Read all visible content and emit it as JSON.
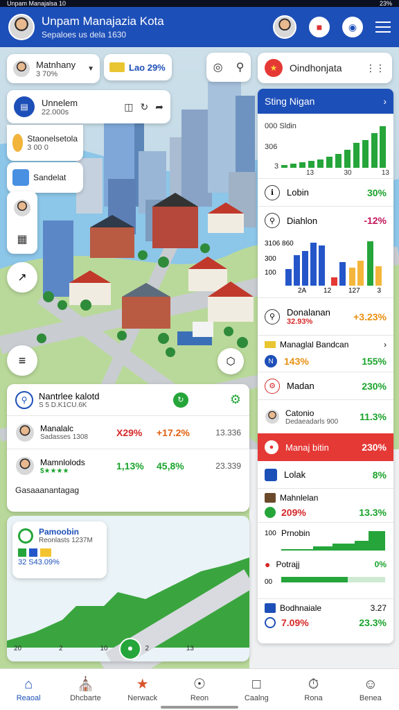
{
  "status_bar": {
    "left": "Unpam Manajalsa 10",
    "right": "23%"
  },
  "header": {
    "title": "Unpam Manajazia Kota",
    "subtitle": "Sepaloes us dela 1630"
  },
  "user_select": {
    "name": "Matnhany",
    "sub": "3 70%"
  },
  "budget_badge": {
    "value": "Lao 29%"
  },
  "side_list": [
    {
      "name": "Unnelem",
      "sub": "22.000s"
    },
    {
      "name": "Staonelsetola",
      "sub": "3 00 0"
    },
    {
      "name": "Sandelat",
      "sub": ""
    }
  ],
  "right_tab": {
    "label": "Oindhonjata"
  },
  "panel": {
    "header": "Sting Nigan",
    "chart1": {
      "label_top": "000 Sldin",
      "label_mid": "306",
      "label_bottom": "3",
      "ticks": [
        "13",
        "30",
        "13"
      ]
    },
    "rows": [
      {
        "label": "Lobin",
        "value": "30%",
        "color": "green"
      },
      {
        "label": "Diahlon",
        "value": "-12%",
        "color": "magenta"
      }
    ],
    "chart2": {
      "labels": [
        "2A",
        "12",
        "127",
        "3"
      ],
      "axis": [
        "3106 860",
        "300",
        "100"
      ]
    },
    "dana": {
      "label": "Donalanan",
      "sub": "32.93%",
      "value": "+3.23%"
    },
    "mana_row": {
      "label": "Managlal Bandcan",
      "left": "143%",
      "right": "155%"
    },
    "madan": {
      "label": "Madan",
      "value": "230%"
    },
    "catonio": {
      "label": "Catonio",
      "sub": "Dedaeadarls 900",
      "value": "11.3%"
    },
    "red_header": {
      "label": "Manaj bitin",
      "value": "230%"
    },
    "list": [
      {
        "label": "Lolak",
        "value": "8%",
        "left": ""
      },
      {
        "label": "Mahnlelan",
        "value": "13.3%",
        "left": "209%"
      }
    ],
    "mini": {
      "axis_top": "100",
      "label": "Prnobin",
      "label2": "Potrajj",
      "value2": "0%",
      "axis_bottom": "00"
    },
    "bottom": {
      "label": "Bodhnaiale",
      "right_top": "3.27",
      "left": "7.09%",
      "right": "23.3%"
    }
  },
  "stats_card": {
    "title": "Nantrlee kalotd",
    "sub": "S 5 D.K1CU.6K",
    "rows": [
      {
        "name": "Manalalc",
        "sub": "Sadasses 1308",
        "v1": "X29%",
        "v2": "+17.2%",
        "v3": "13.336"
      },
      {
        "name": "Mamnlolods",
        "sub": "$★★★★",
        "v1": "1,13%",
        "v2": "45,8%",
        "v3": "23.339"
      }
    ],
    "footer": "Gasaaanantagag"
  },
  "area_card": {
    "title": "Pamoobin",
    "sub": "Reonlasts 1237M",
    "legend": "32 S43.09%",
    "x_ticks": [
      "20",
      "2",
      "10",
      "2",
      "13"
    ]
  },
  "bottom_nav": [
    {
      "label": "Reaoal",
      "icon": "home-icon",
      "active": true
    },
    {
      "label": "Dhcbarte",
      "icon": "building-icon",
      "active": false
    },
    {
      "label": "Nerwack",
      "icon": "network-icon",
      "active": false
    },
    {
      "label": "Reon",
      "icon": "compass-icon",
      "active": false
    },
    {
      "label": "Caalng",
      "icon": "message-icon",
      "active": false
    },
    {
      "label": "Rona",
      "icon": "timer-icon",
      "active": false
    },
    {
      "label": "Benea",
      "icon": "user-icon",
      "active": false
    }
  ],
  "colors": {
    "primary": "#1d4fb8",
    "green": "#1aa32b",
    "red": "#d62828",
    "panel_red": "#e53935"
  }
}
